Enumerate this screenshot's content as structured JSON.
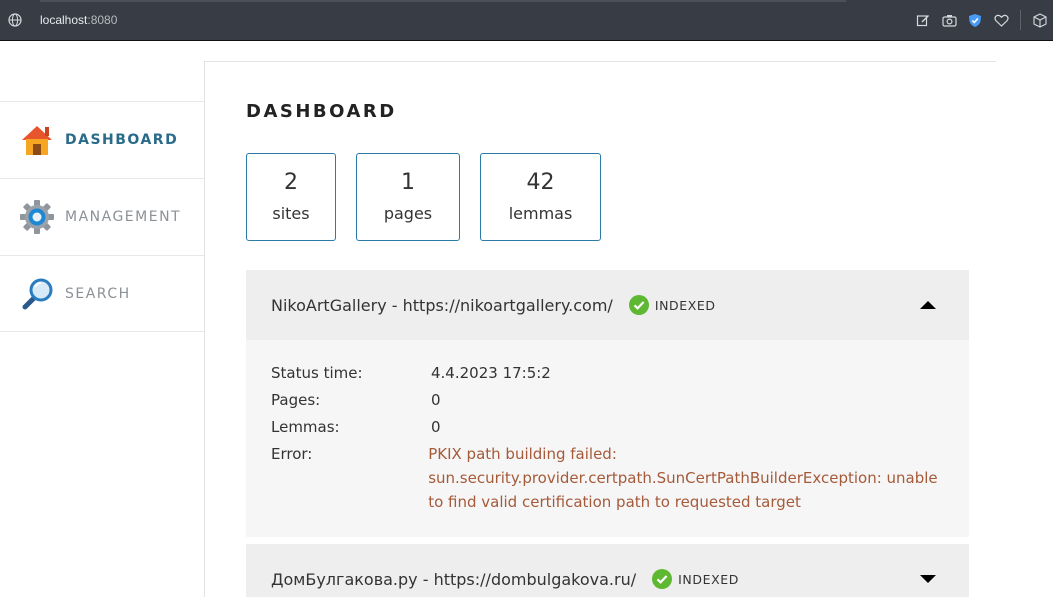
{
  "browser": {
    "url_host": "localhost",
    "url_port": ":8080"
  },
  "sidebar": {
    "items": [
      {
        "label": "DASHBOARD",
        "icon": "home-icon",
        "active": true
      },
      {
        "label": "MANAGEMENT",
        "icon": "gear-icon",
        "active": false
      },
      {
        "label": "SEARCH",
        "icon": "magnifier-icon",
        "active": false
      }
    ]
  },
  "main": {
    "title": "DASHBOARD",
    "stats": [
      {
        "value": "2",
        "label": "sites"
      },
      {
        "value": "1",
        "label": "pages"
      },
      {
        "value": "42",
        "label": "lemmas"
      }
    ],
    "sites": [
      {
        "name": "NikoArtGallery - https://nikoartgallery.com/",
        "status": "INDEXED",
        "expanded": true,
        "details": {
          "status_time_label": "Status time:",
          "status_time": "4.4.2023 17:5:2",
          "pages_label": "Pages:",
          "pages": "0",
          "lemmas_label": "Lemmas:",
          "lemmas": "0",
          "error_label": "Error:",
          "error": "PKIX path building failed: sun.security.provider.certpath.SunCertPathBuilderException: unable to find valid certification path to requested target"
        }
      },
      {
        "name": "ДомБулгакова.ру - https://dombulgakova.ru/",
        "status": "INDEXED",
        "expanded": false
      }
    ]
  },
  "colors": {
    "accent": "#2c7aa6",
    "error": "#a55a3a",
    "indexed": "#5fb832"
  }
}
